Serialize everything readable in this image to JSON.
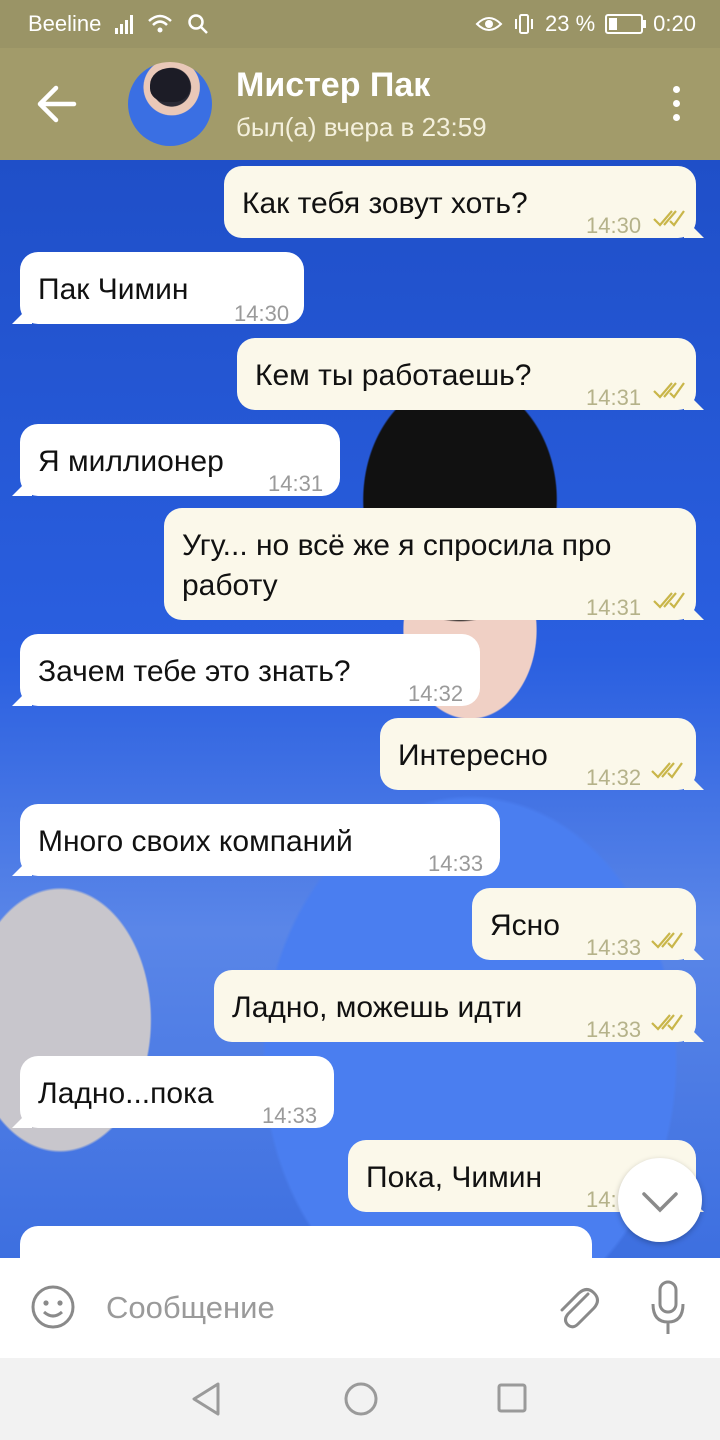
{
  "status_bar": {
    "carrier": "Beeline",
    "battery_percent": "23 %",
    "time": "0:20"
  },
  "header": {
    "name": "Мистер Пак",
    "last_seen": "был(а) вчера в 23:59"
  },
  "messages": [
    {
      "dir": "out",
      "lines": [
        "Как тебя зовут хоть?"
      ],
      "time": "14:30"
    },
    {
      "dir": "in",
      "lines": [
        "Пак Чимин"
      ],
      "time": "14:30"
    },
    {
      "dir": "out",
      "lines": [
        "Кем ты работаешь?"
      ],
      "time": "14:31"
    },
    {
      "dir": "in",
      "lines": [
        "Я миллионер"
      ],
      "time": "14:31"
    },
    {
      "dir": "out",
      "lines": [
        "Угу... но всё же я спросила про",
        "работу"
      ],
      "time": "14:31"
    },
    {
      "dir": "in",
      "lines": [
        "Зачем тебе это знать?"
      ],
      "time": "14:32"
    },
    {
      "dir": "out",
      "lines": [
        "Интересно"
      ],
      "time": "14:32"
    },
    {
      "dir": "in",
      "lines": [
        "Много своих компаний"
      ],
      "time": "14:33"
    },
    {
      "dir": "out",
      "lines": [
        "Ясно"
      ],
      "time": "14:33"
    },
    {
      "dir": "out",
      "lines": [
        "Ладно, можешь идти"
      ],
      "time": "14:33"
    },
    {
      "dir": "in",
      "lines": [
        "Ладно...пока"
      ],
      "time": "14:33"
    },
    {
      "dir": "out",
      "lines": [
        "Пока, Чимин"
      ],
      "time": "14:"
    }
  ],
  "input": {
    "placeholder": "Сообщение"
  },
  "colors": {
    "header": "#a29b6a",
    "status_bar": "#9a9466",
    "incoming_bubble": "#ffffff",
    "outgoing_bubble": "#fbf8ea",
    "tick": "#c9b64a"
  },
  "icons": [
    "back-arrow-icon",
    "more-vert-icon",
    "double-check-icon",
    "chevron-down-icon",
    "emoji-icon",
    "paperclip-icon",
    "microphone-icon",
    "nav-back-icon",
    "nav-home-icon",
    "nav-recent-icon"
  ]
}
